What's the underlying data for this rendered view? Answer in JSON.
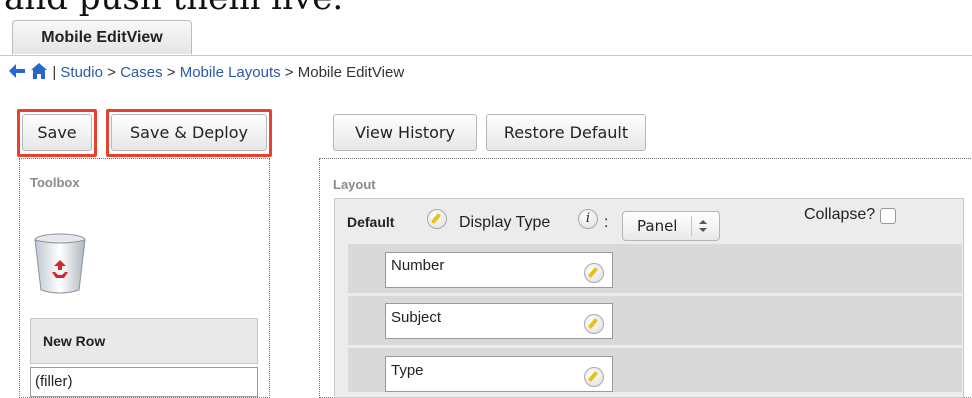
{
  "caption": {
    "text": "and push them live."
  },
  "tab": {
    "label": "Mobile EditView"
  },
  "breadcrumb": {
    "separator": "|",
    "items": [
      "Studio",
      "Cases",
      "Mobile Layouts",
      "Mobile EditView"
    ],
    "arrows": [
      ">",
      ">",
      ">"
    ]
  },
  "toolbar": {
    "save_label": "Save",
    "save_deploy_label": "Save & Deploy",
    "view_history_label": "View History",
    "restore_default_label": "Restore Default"
  },
  "toolbox": {
    "title": "Toolbox",
    "new_row_label": "New Row",
    "filler_label": "(filler)"
  },
  "layout": {
    "title": "Layout",
    "panel_name": "Default",
    "display_type_label": "Display Type",
    "info_glyph": "i",
    "colon": ":",
    "display_type_value": "Panel",
    "collapse_label": "Collapse?",
    "fields": [
      "Number",
      "Subject",
      "Type"
    ]
  },
  "colors": {
    "highlight": "#e8412c",
    "link": "#2a5aa8"
  }
}
